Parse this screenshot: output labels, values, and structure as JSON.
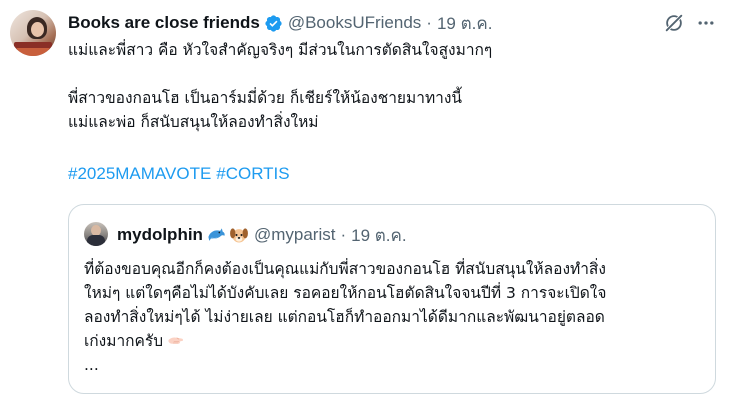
{
  "tweet": {
    "author": {
      "name": "Books are close friends",
      "handle": "@BooksUFriends",
      "separator": "·",
      "date": "19 ต.ค."
    },
    "lines": [
      "แม่และพี่สาว คือ หัวใจสำคัญจริงๆ มีส่วนในการตัดสินใจสูงมากๆ",
      "",
      "พี่สาวของกอนโฮ เป็นอาร์มมี่ด้วย ก็เชียร์ให้น้องชายมาทางนี้",
      "แม่และพ่อ ก็สนับสนุนให้ลองทำสิ่งใหม่"
    ],
    "hashtags": [
      "#2025MAMAVOTE",
      "#CORTIS"
    ]
  },
  "quoted": {
    "author": {
      "name": "mydolphin",
      "emoji_1": "dolphin-emoji",
      "emoji_2": "dog-face-emoji",
      "handle": "@myparist",
      "separator": "·",
      "date": "19 ต.ค."
    },
    "lines": [
      "ที่ต้องขอบคุณอีกก็คงต้องเป็นคุณแม่กับพี่สาวของกอนโฮ ที่สนับสนุนให้ลองทำสิ่ง",
      "ใหม่ๆ แต่ใดๆคือไม่ได้บังคับเลย รอคอยให้กอนโฮตัดสินใจจนปีที่ 3 การจะเปิดใจ",
      "ลองทำสิ่งใหม่ๆได้ ไม่ง่ายเลย แต่กอนโฮก็ทำออกมาได้ดีมากและพัฒนาอยู่ตลอด",
      "เก่งมากครับ",
      "..."
    ],
    "trailing_icon": "handshake-hand-emoji"
  },
  "colors": {
    "accent": "#1d9bf0",
    "text": "#0f1419",
    "secondary": "#536471",
    "border": "#cfd9de"
  },
  "icons": {
    "verified": "verified-badge-icon",
    "grok": "grok-icon",
    "more": "more-icon"
  }
}
